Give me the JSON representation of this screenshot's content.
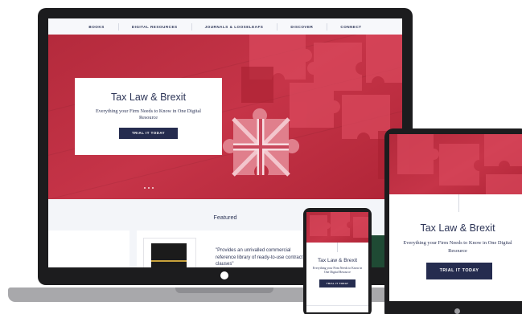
{
  "nav": {
    "items": [
      "BOOKS",
      "DIGITAL RESOURCES",
      "JOURNALS & LOOSELEAFS",
      "DISCOVER",
      "CONNECT"
    ]
  },
  "hero": {
    "title": "Tax Law & Brexit",
    "subtitle": "Everything your Firm Needs to Know in One Digital Resource",
    "cta": "TRIAL IT TODAY"
  },
  "featured": {
    "heading": "Featured",
    "quote": "\"Provides an unrivalled commercial reference library of ready-to-use contract clauses\""
  },
  "tablet": {
    "title": "Tax Law & Brexit",
    "subtitle": "Everything your Firm Needs to Know in One Digital Resource",
    "cta": "TRIAL IT TODAY"
  },
  "phone": {
    "title": "Tax Law & Brexit",
    "subtitle": "Everything your Firm Needs to Know in One Digital Resource",
    "cta": "TRIAL IT TODAY"
  },
  "colors": {
    "brand_red": "#c63448",
    "navy": "#252c4f",
    "text_navy": "#2d3557",
    "device_frame": "#1c1c1e"
  }
}
